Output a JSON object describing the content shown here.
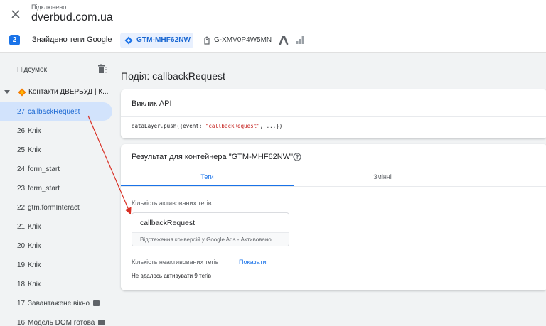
{
  "header": {
    "status": "Підключено",
    "domain": "dverbud.com.ua",
    "close_icon": "close-icon"
  },
  "tag_bar": {
    "count": "2",
    "found_label": "Знайдено теги Google",
    "containers": [
      {
        "id": "GTM-MHF62NW",
        "icon": "gtm-diamond-icon",
        "selected": true
      },
      {
        "id": "G-XMV0P4W5MN",
        "icon": "ga-tag-icon",
        "selected": false
      }
    ],
    "product_icons": [
      "google-ads-icon",
      "analytics-icon"
    ]
  },
  "sidebar": {
    "title": "Підсумок",
    "container_label": "Контакти ДВЕРБУД | К...",
    "items": [
      {
        "num": "27",
        "name": "callbackRequest",
        "active": true
      },
      {
        "num": "26",
        "name": "Клік"
      },
      {
        "num": "25",
        "name": "Клік"
      },
      {
        "num": "24",
        "name": "form_start"
      },
      {
        "num": "23",
        "name": "form_start"
      },
      {
        "num": "22",
        "name": "gtm.formInteract"
      },
      {
        "num": "21",
        "name": "Клік"
      },
      {
        "num": "20",
        "name": "Клік"
      },
      {
        "num": "19",
        "name": "Клік"
      },
      {
        "num": "18",
        "name": "Клік"
      },
      {
        "num": "17",
        "name": "Завантажене вікно",
        "badge": true
      },
      {
        "num": "16",
        "name": "Модель DOM готова",
        "badge": true
      }
    ]
  },
  "main": {
    "title": "Подія: callbackRequest",
    "api_card": {
      "title": "Виклик API",
      "code_prefix": "dataLayer.push({event: ",
      "code_string": "\"callbackRequest\"",
      "code_suffix": ", ...})"
    },
    "result_card": {
      "title": "Результат для контейнера \"GTM-MHF62NW\"",
      "tabs": [
        "Теги",
        "Змінні"
      ],
      "active_tab": "Теги",
      "fired_label": "Кількість активованих тегів",
      "fired_tags": [
        {
          "name": "callbackRequest",
          "detail": "Відстеження конверсій у Google Ads - Активовано"
        }
      ],
      "not_fired_label": "Кількість неактивованих тегів",
      "show_link": "Показати",
      "failed_text": "Не вдалось активувати 9 тегів"
    }
  },
  "colors": {
    "accent": "#1a73e8",
    "active_item_bg": "#d2e3fc",
    "annotation_arrow": "#d93025",
    "gtm_orange": "#f57c00"
  }
}
